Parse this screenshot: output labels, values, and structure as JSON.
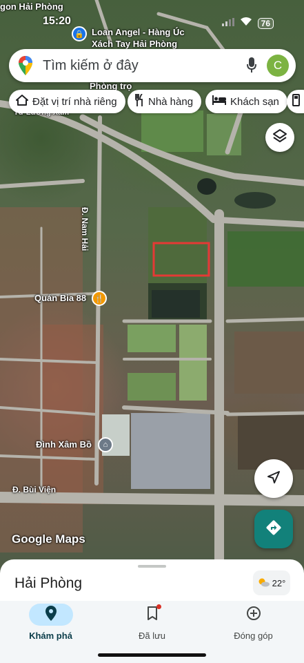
{
  "status_bar": {
    "time": "15:20",
    "battery": "76"
  },
  "search": {
    "placeholder": "Tìm kiếm ở đây",
    "avatar_letter": "C",
    "icons": [
      "maps-pin-icon",
      "mic-icon"
    ]
  },
  "chips": [
    {
      "label": "Đặt vị trí nhà riêng",
      "icon": "home-icon"
    },
    {
      "label": "Nhà hàng",
      "icon": "restaurant-icon"
    },
    {
      "label": "Khách sạn",
      "icon": "hotel-icon"
    }
  ],
  "map": {
    "labels": {
      "top_city": "gon Hải Phòng",
      "poi_shop": "Loan Angel - Hàng Úc Xách Tay Hải Phòng",
      "phong_tro": "Phòng trọ",
      "tu_luong_xam": "Tư Lương Xâm",
      "street_nam_hai": "Đ. Nam Hải",
      "quan_bia": "Quán Bia 88",
      "dinh_xam_bo": "Đình Xâm Bồ",
      "street_bui_vien": "Đ. Bùi Viện"
    },
    "highlight_color": "#e53935",
    "watermark": "Google Maps"
  },
  "bottom_sheet": {
    "title": "Hải Phòng",
    "temperature": "22°",
    "weather_icon": "partly-cloudy-icon"
  },
  "nav": [
    {
      "label": "Khám phá",
      "icon": "location-pin-icon",
      "active": true
    },
    {
      "label": "Đã lưu",
      "icon": "bookmark-icon",
      "active": false
    },
    {
      "label": "Đóng góp",
      "icon": "add-circle-icon",
      "active": false
    }
  ],
  "colors": {
    "accent": "#12817a",
    "nav_active_bg": "#c2e7ff"
  }
}
